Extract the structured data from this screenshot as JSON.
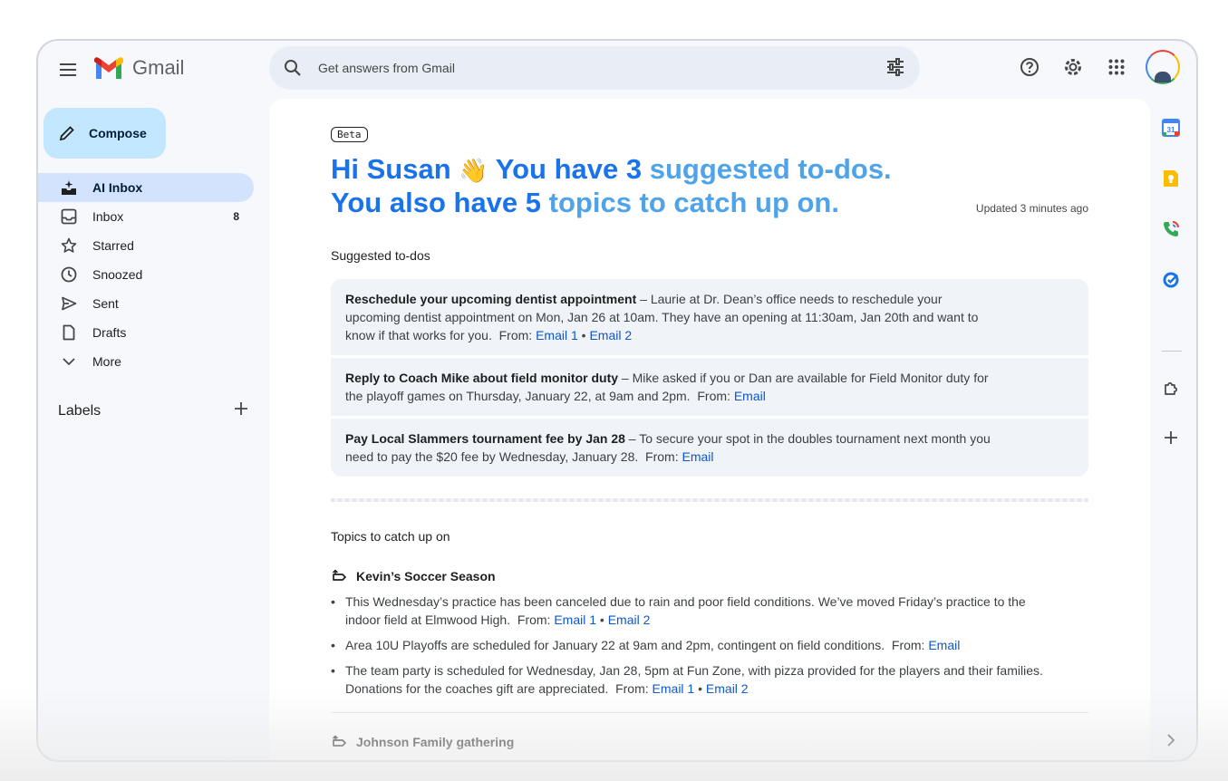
{
  "app": {
    "name": "Gmail"
  },
  "search": {
    "placeholder": "Get answers from Gmail"
  },
  "sidebar": {
    "compose_label": "Compose",
    "items": [
      {
        "label": "AI Inbox",
        "count": "",
        "active": true
      },
      {
        "label": "Inbox",
        "count": "8"
      },
      {
        "label": "Starred",
        "count": ""
      },
      {
        "label": "Snoozed",
        "count": ""
      },
      {
        "label": "Sent",
        "count": ""
      },
      {
        "label": "Drafts",
        "count": ""
      },
      {
        "label": "More",
        "count": ""
      }
    ],
    "labels_heading": "Labels"
  },
  "main": {
    "beta_badge": "Beta",
    "greeting": {
      "hi": "Hi Susan",
      "wave": "👋",
      "part1": "You have 3",
      "part2": "suggested to-dos.",
      "part3": "You also have 5",
      "part4": "topics to catch up on."
    },
    "updated": "Updated 3 minutes ago",
    "todos_heading": "Suggested to-dos",
    "todos": [
      {
        "title": "Reschedule your upcoming dentist appointment",
        "text": " – Laurie at Dr. Dean’s office needs to reschedule your upcoming dentist appointment on Mon, Jan 26 at 10am. They have an opening at 11:30am, Jan 20th and want to know if that works for you.",
        "from": "From:",
        "links": [
          "Email 1",
          "Email 2"
        ]
      },
      {
        "title": "Reply to Coach Mike about field monitor duty",
        "text": " – Mike asked if you or Dan are available for Field Monitor duty for the playoff games on Thursday, January 22, at 9am and 2pm.",
        "from": "From:",
        "links": [
          "Email"
        ]
      },
      {
        "title": "Pay Local Slammers tournament fee by Jan 28",
        "text": " – To secure your spot in the doubles tournament next month you need to pay the $20 fee by Wednesday, January 28.",
        "from": "From:",
        "links": [
          "Email"
        ]
      }
    ],
    "topics_heading": "Topics to catch up on",
    "topics": [
      {
        "title": "Kevin’s Soccer Season",
        "bullets": [
          {
            "text": "This Wednesday’s practice has been canceled due to rain and poor field conditions. We’ve moved Friday’s practice to the indoor field at Elmwood High.",
            "from": "From:",
            "links": [
              "Email 1",
              "Email 2"
            ]
          },
          {
            "text": "Area 10U Playoffs are scheduled for January 22 at 9am and 2pm, contingent on field conditions.",
            "from": "From:",
            "links": [
              "Email"
            ]
          },
          {
            "text": "The team party is scheduled for Wednesday, Jan 28, 5pm at Fun Zone, with pizza provided for the players and their families. Donations for the coaches gift are appreciated.",
            "from": "From:",
            "links": [
              "Email 1",
              "Email 2"
            ]
          }
        ]
      },
      {
        "title": "Johnson Family gathering"
      }
    ],
    "link_separator": "•"
  },
  "rail": {
    "icons": [
      "calendar-icon",
      "keep-icon",
      "phone-icon",
      "tasks-icon",
      "addons-icon",
      "add-icon",
      "chevron-right-icon"
    ],
    "calendar_day": "31"
  },
  "colors": {
    "accent": "#1a73e8",
    "accent_light": "#4fa3e8",
    "compose_bg": "#c2e7ff",
    "active_nav": "#d3e3fd",
    "link": "#0b57d0"
  }
}
